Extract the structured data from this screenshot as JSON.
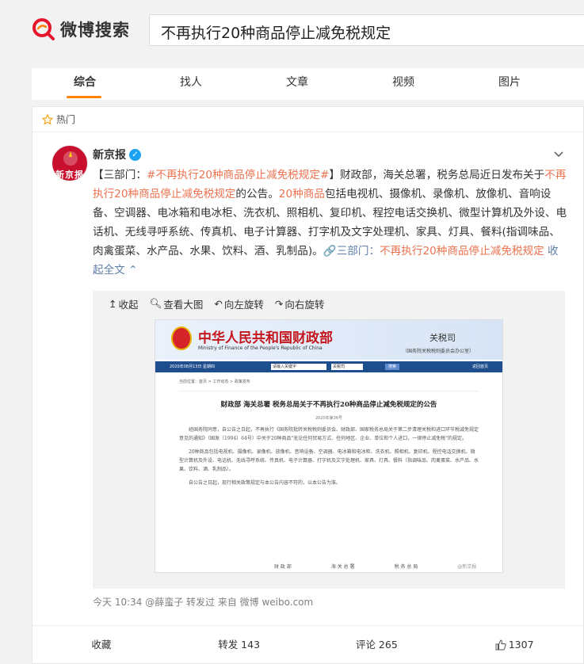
{
  "header": {
    "logo_text": "微博搜索",
    "search_value": "不再执行20种商品停止减免税规定"
  },
  "tabs": [
    {
      "label": "综合",
      "active": true
    },
    {
      "label": "找人",
      "active": false
    },
    {
      "label": "文章",
      "active": false
    },
    {
      "label": "视频",
      "active": false
    },
    {
      "label": "图片",
      "active": false
    }
  ],
  "section": {
    "label": "热门"
  },
  "post": {
    "author": "新京报",
    "avatar_text": "新京报",
    "verified": true,
    "text": {
      "p1": "【三部门：",
      "tag1": "#不再执行20种商品停止减免税规定#",
      "p2": "】财政部，海关总署，税务总局近日发布关于",
      "hl1": "不再执行20种商品停止减免税规定",
      "p3": "的公告。",
      "hl2": "20种商品",
      "p4": "包括电视机、摄像机、录像机、放像机、音响设备、空调器、电冰箱和电冰柜、洗衣机、照相机、复印机、程控电话交换机、微型计算机及外设、电话机、无线寻呼系统、传真机、电子计算器、打字机及文字处理机、家具、灯具、餐料(指调味品、肉禽蛋菜、水产品、水果、饮料、酒、乳制品)。",
      "link_prefix": "三部门：",
      "link_hl": "不再执行20种商品停止减免税规定",
      "collapse": "收起全文"
    },
    "media_toolbar": {
      "collapse": "收起",
      "view_large": "查看大图",
      "rotate_left": "向左旋转",
      "rotate_right": "向右旋转"
    },
    "doc": {
      "title": "中华人民共和国财政部",
      "subtitle": "Ministry of Finance of the People's Republic of China",
      "dept": "关税司",
      "dept_sub": "（国务院关税税则委员会办公室）",
      "nav_date": "2020年08月13日 星期四",
      "search_placeholder": "请输入关键字",
      "select": "关税司",
      "search_btn": "搜索",
      "nav_right": "返回首页",
      "crumb": "当前位置：首页 > 工作动态 > 政策发布",
      "heading": "财政部 海关总署 税务总局关于不再执行20种商品停止减免税规定的公告",
      "number": "2020年第36号",
      "para1": "经国务院同意，自公告之日起，不再执行《国务院批转关税税则委员会、财政部、国家税务总局关于第二步清理关税和进口环节税减免规定意见的通知》（国发〔1994〕64号）中关于20种商品\"无论任何贸易方式、任何地区、企业、单位和个人进口，一律停止减免税\"的规定。",
      "para2": "20种商品包括电视机、摄像机、录像机、放像机、音响设备、空调器、电冰箱和电冰柜、洗衣机、照相机、复印机、程控电话交换机、微型计算机及外设、电话机、无线寻呼系统、传真机、电子计算器、打字机及文字处理机、家具、灯具、餐料（指调味品、肉禽蛋菜、水产品、水果、饮料、酒、乳制品）。",
      "para3": "自公告之日起，现行相关政策规定与本公告内容不符的，以本公告为准。",
      "sig1": "财 政 部",
      "sig2": "海 关 总 署",
      "sig3": "税 务 总 局",
      "watermark": "@新京报"
    },
    "meta": "今天 10:34 @薛蛮子 转发过  来自 微博 weibo.com",
    "actions": {
      "favorite": "收藏",
      "repost": "转发 143",
      "comment": "评论 265",
      "like": "1307"
    }
  },
  "colors": {
    "accent": "#ff8200",
    "link": "#eb7350",
    "blue_link": "#5d7ea6"
  }
}
